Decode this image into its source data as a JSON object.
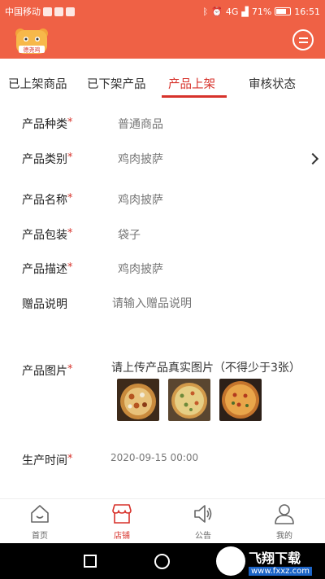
{
  "status_bar": {
    "carrier": "中国移动",
    "network": "4G",
    "battery": "71%",
    "battery_level": 0.71,
    "time": "16:51"
  },
  "header": {
    "logo_text": "德尧鸡"
  },
  "tabs": [
    {
      "label": "已上架商品",
      "active": false
    },
    {
      "label": "已下架产品",
      "active": false
    },
    {
      "label": "产品上架",
      "active": true
    },
    {
      "label": "审核状态",
      "active": false
    }
  ],
  "form": {
    "product_type": {
      "label": "产品种类",
      "required_mark": "*",
      "value": "普通商品"
    },
    "product_category": {
      "label": "产品类别",
      "required_mark": "*",
      "value": "鸡肉披萨"
    },
    "product_name": {
      "label": "产品名称",
      "required_mark": "*",
      "value": "鸡肉披萨"
    },
    "product_packaging": {
      "label": "产品包装",
      "required_mark": "*",
      "value": "袋子"
    },
    "product_description": {
      "label": "产品描述",
      "required_mark": "*",
      "value": "鸡肉披萨"
    },
    "gift_note": {
      "label": "赠品说明",
      "placeholder": "请输入赠品说明"
    },
    "product_images": {
      "label": "产品图片",
      "required_mark": "*",
      "hint": "请上传产品真实图片（不得少于3张）",
      "count": 3
    },
    "production_time": {
      "label": "生产时间",
      "required_mark": "*",
      "value": "2020-09-15 00:00"
    }
  },
  "bottom_nav": [
    {
      "label": "首页",
      "icon": "home-icon",
      "active": false
    },
    {
      "label": "店铺",
      "icon": "store-icon",
      "active": true
    },
    {
      "label": "公告",
      "icon": "speaker-icon",
      "active": false
    },
    {
      "label": "我的",
      "icon": "user-icon",
      "active": false
    }
  ],
  "watermark": {
    "title": "飞翔下载",
    "url": "www.fxxz.com"
  },
  "colors": {
    "brand": "#ef6145",
    "accent": "#d7322b"
  }
}
